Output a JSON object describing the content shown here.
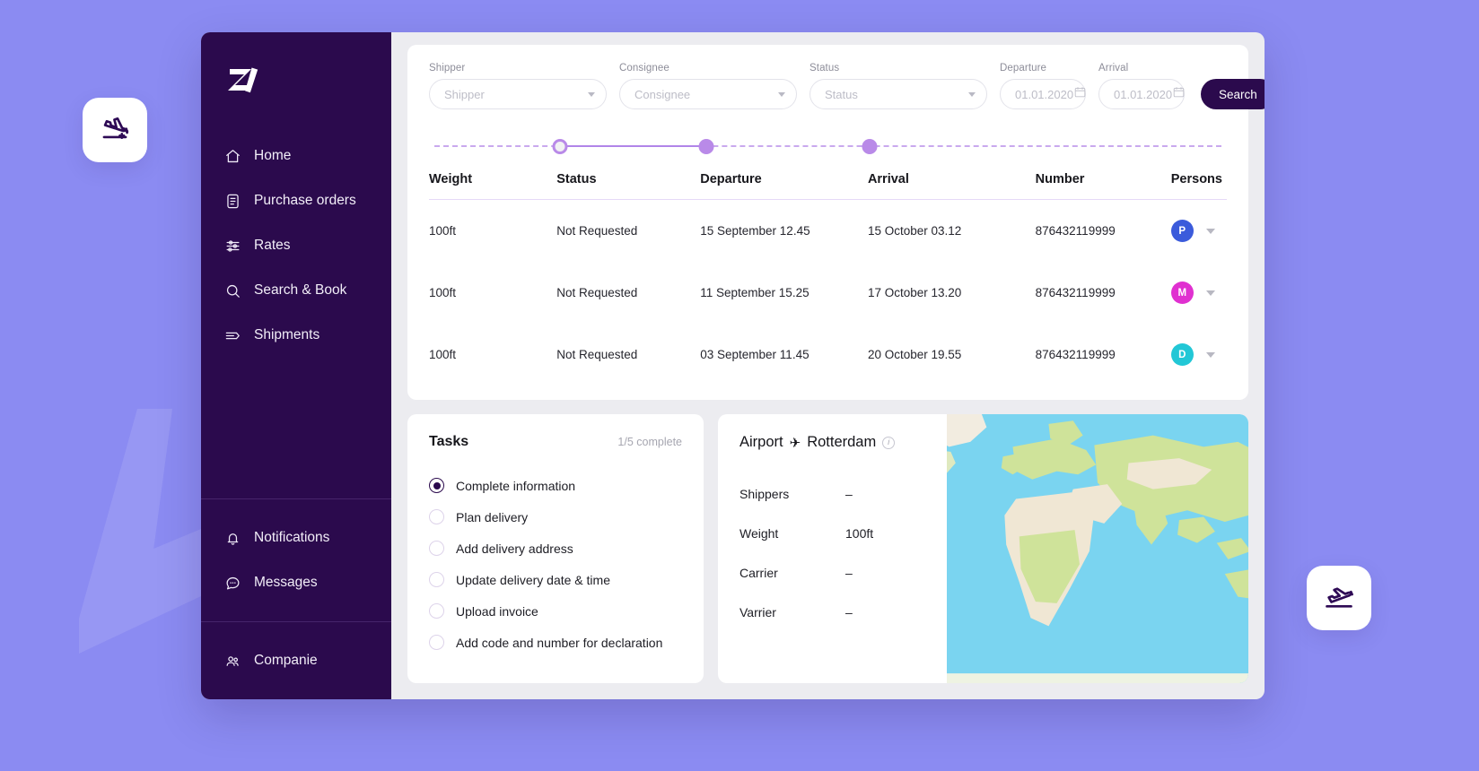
{
  "background": {
    "color": "#8b8bf2",
    "watermark_icon": "plane-watermark"
  },
  "float_buttons": [
    {
      "name": "plane-landing-icon",
      "position": "left"
    },
    {
      "name": "plane-takeoff-icon",
      "position": "right"
    }
  ],
  "sidebar": {
    "logo": "zz-logo",
    "primary_items": [
      {
        "label": "Home",
        "icon": "home-icon"
      },
      {
        "label": "Purchase orders",
        "icon": "document-icon"
      },
      {
        "label": "Rates",
        "icon": "sliders-icon"
      },
      {
        "label": "Search & Book",
        "icon": "search-icon"
      },
      {
        "label": "Shipments",
        "icon": "shipments-arrow-icon"
      }
    ],
    "secondary_items": [
      {
        "label": "Notifications",
        "icon": "bell-icon"
      },
      {
        "label": "Messages",
        "icon": "chat-icon"
      }
    ],
    "footer_items": [
      {
        "label": "Companie",
        "icon": "users-icon"
      }
    ]
  },
  "filters": {
    "shipper": {
      "label": "Shipper",
      "placeholder": "Shipper"
    },
    "consignee": {
      "label": "Consignee",
      "placeholder": "Consignee"
    },
    "status": {
      "label": "Status",
      "placeholder": "Status"
    },
    "departure": {
      "label": "Departure",
      "placeholder": "01.01.2020"
    },
    "arrival": {
      "label": "Arrival",
      "placeholder": "01.01.2020"
    },
    "search_label": "Search"
  },
  "progress_slider": {
    "nodes": [
      {
        "position_pct": 16.0,
        "state": "current"
      },
      {
        "position_pct": 34.6,
        "state": "done"
      },
      {
        "position_pct": 55.3,
        "state": "done"
      }
    ],
    "track_color": "#c9a9ee",
    "active_color": "#b185e8"
  },
  "table": {
    "columns": [
      "Weight",
      "Status",
      "Departure",
      "Arrival",
      "Number",
      "Persons"
    ],
    "rows": [
      {
        "weight": "100ft",
        "status": "Not Requested",
        "departure": "15 September 12.45",
        "arrival": "15 October  03.12",
        "number": "876432119999",
        "person_initial": "P",
        "person_color": "#3b5bdb"
      },
      {
        "weight": "100ft",
        "status": "Not Requested",
        "departure": "11 September 15.25",
        "arrival": "17 October  13.20",
        "number": "876432119999",
        "person_initial": "M",
        "person_color": "#e030d0"
      },
      {
        "weight": "100ft",
        "status": "Not Requested",
        "departure": "03 September 11.45",
        "arrival": "20 October  19.55",
        "number": "876432119999",
        "person_initial": "D",
        "person_color": "#22c7d6"
      }
    ]
  },
  "tasks": {
    "title": "Tasks",
    "progress": "1/5 complete",
    "items": [
      {
        "label": "Complete information",
        "done": true
      },
      {
        "label": "Plan delivery",
        "done": false
      },
      {
        "label": "Add delivery address",
        "done": false
      },
      {
        "label": "Update delivery date & time",
        "done": false
      },
      {
        "label": "Upload invoice",
        "done": false
      },
      {
        "label": "Add code and number for declaration",
        "done": false
      }
    ]
  },
  "airport": {
    "title_prefix": "Airport",
    "plane_glyph": "✈",
    "title_suffix": "Rotterdam",
    "info_icon": "i",
    "rows": [
      {
        "key": "Shippers",
        "value": "–"
      },
      {
        "key": "Weight",
        "value": "100ft"
      },
      {
        "key": "Carrier",
        "value": "–"
      },
      {
        "key": "Varrier",
        "value": "–"
      }
    ],
    "map": {
      "ocean_color": "#7ad4f0",
      "land_color": "#cfe39a",
      "desert_color": "#f0e7d4"
    }
  }
}
